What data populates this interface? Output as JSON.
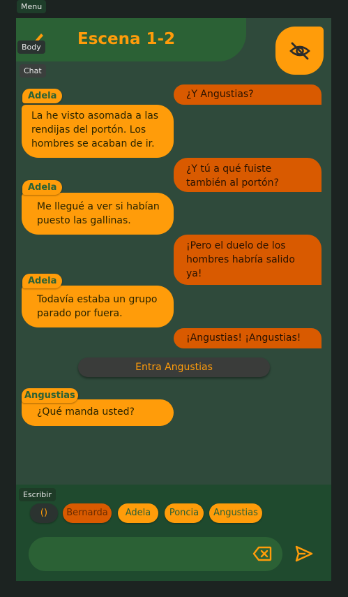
{
  "debug_tags": {
    "menu": "Menu",
    "body": "Body",
    "chat": "Chat",
    "escribir": "Escribir"
  },
  "header": {
    "title": "Escena 1-2"
  },
  "messages": [
    {
      "side": "right",
      "text": "¿Y Angustias?"
    },
    {
      "side": "left",
      "speaker": "Adela",
      "text": "La he visto asomada a las rendijas del portón. Los hombres se acaban de ir."
    },
    {
      "side": "right",
      "text": "¿Y tú a qué fuiste también al portón?"
    },
    {
      "side": "left",
      "speaker": "Adela",
      "text": "Me llegué a ver si habían puesto las gallinas."
    },
    {
      "side": "right",
      "text": "¡Pero el duelo de los hombres habría salido ya!"
    },
    {
      "side": "left",
      "speaker": "Adela",
      "text": "Todavía estaba un grupo parado por fuera."
    },
    {
      "side": "right",
      "text": "¡Angustias! ¡Angustias!"
    },
    {
      "side": "stage",
      "text": "Entra Angustias"
    },
    {
      "side": "left",
      "speaker": "Angustias",
      "text": "¿Qué manda usted?"
    }
  ],
  "composer": {
    "chips": [
      {
        "label": "()"
      },
      {
        "label": "Bernarda",
        "selected": true
      },
      {
        "label": "Adela"
      },
      {
        "label": "Poncia"
      },
      {
        "label": "Angustias"
      }
    ],
    "input_value": ""
  },
  "colors": {
    "accent": "#ff9c0a",
    "accent_dark": "#d95a00",
    "header_green": "#2b6135",
    "panel": "#2f4a3b",
    "footer": "#1f4a2e"
  },
  "icons": {
    "edit": "pencil-icon",
    "hide": "eye-off-icon",
    "clear": "backspace-icon",
    "send": "send-icon"
  }
}
